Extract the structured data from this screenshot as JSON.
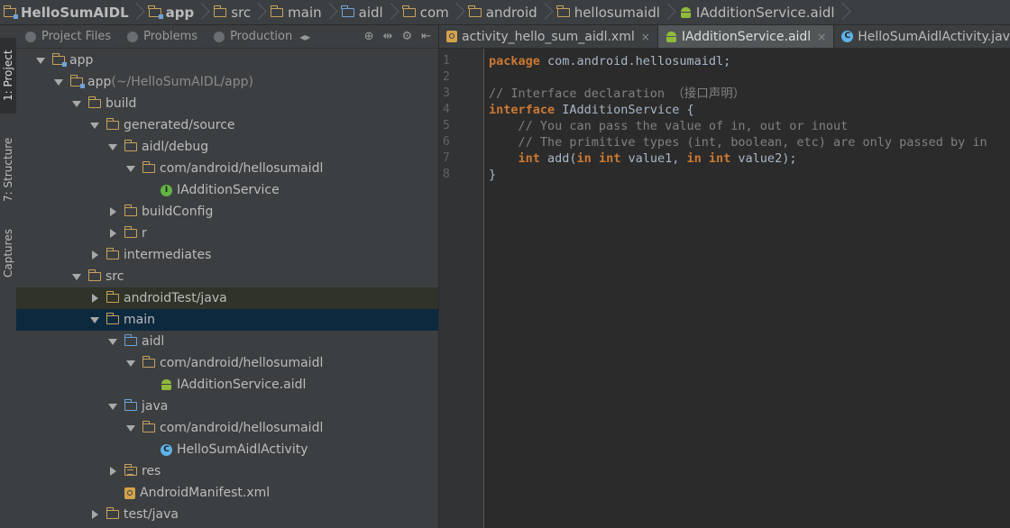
{
  "breadcrumb": [
    {
      "label": "HelloSumAIDL",
      "icon": "module-folder-icon",
      "bold": true
    },
    {
      "label": "app",
      "icon": "module-folder-icon",
      "bold": true
    },
    {
      "label": "src",
      "icon": "folder-icon"
    },
    {
      "label": "main",
      "icon": "folder-icon"
    },
    {
      "label": "aidl",
      "icon": "blue-folder-icon"
    },
    {
      "label": "com",
      "icon": "folder-icon"
    },
    {
      "label": "android",
      "icon": "folder-icon"
    },
    {
      "label": "hellosumaidl",
      "icon": "folder-icon"
    },
    {
      "label": "IAdditionService.aidl",
      "icon": "android-icon"
    }
  ],
  "left_stripe": {
    "project": "1: Project",
    "structure": "7: Structure",
    "captures": "Captures"
  },
  "panel_tabs": [
    "Project Files",
    "Problems",
    "Production"
  ],
  "panel_tools": {
    "arrows": "◂▸",
    "target": "⊕",
    "split": "⇹",
    "gear": "⚙",
    "hide": "⇤"
  },
  "tree": [
    {
      "label": "app",
      "suffix": "",
      "indent": 0,
      "arrow": "down",
      "icon": "module-folder-icon"
    },
    {
      "label": "app",
      "suffix": " (~/HelloSumAIDL/app)",
      "indent": 1,
      "arrow": "down",
      "icon": "module-folder-icon"
    },
    {
      "label": "build",
      "suffix": "",
      "indent": 2,
      "arrow": "down",
      "icon": "folder-icon"
    },
    {
      "label": "generated/source",
      "suffix": "",
      "indent": 3,
      "arrow": "down",
      "icon": "folder-icon"
    },
    {
      "label": "aidl/debug",
      "suffix": "",
      "indent": 4,
      "arrow": "down",
      "icon": "folder-icon"
    },
    {
      "label": "com/android/hellosumaidl",
      "suffix": "",
      "indent": 5,
      "arrow": "down",
      "icon": "folder-icon"
    },
    {
      "label": "IAdditionService",
      "suffix": "",
      "indent": 6,
      "arrow": "none",
      "icon": "interface-icon"
    },
    {
      "label": "buildConfig",
      "suffix": "",
      "indent": 4,
      "arrow": "right",
      "icon": "folder-icon"
    },
    {
      "label": "r",
      "suffix": "",
      "indent": 4,
      "arrow": "right",
      "icon": "folder-icon"
    },
    {
      "label": "intermediates",
      "suffix": "",
      "indent": 3,
      "arrow": "right",
      "icon": "folder-icon"
    },
    {
      "label": "src",
      "suffix": "",
      "indent": 2,
      "arrow": "down",
      "icon": "folder-icon"
    },
    {
      "label": "androidTest/java",
      "suffix": "",
      "indent": 3,
      "arrow": "right",
      "icon": "folder-icon",
      "state": "tested"
    },
    {
      "label": "main",
      "suffix": "",
      "indent": 3,
      "arrow": "down",
      "icon": "folder-icon",
      "state": "selected"
    },
    {
      "label": "aidl",
      "suffix": "",
      "indent": 4,
      "arrow": "down",
      "icon": "blue-folder-icon"
    },
    {
      "label": "com/android/hellosumaidl",
      "suffix": "",
      "indent": 5,
      "arrow": "down",
      "icon": "folder-icon"
    },
    {
      "label": "IAdditionService.aidl",
      "suffix": "",
      "indent": 6,
      "arrow": "none",
      "icon": "android-icon"
    },
    {
      "label": "java",
      "suffix": "",
      "indent": 4,
      "arrow": "down",
      "icon": "blue-folder-icon"
    },
    {
      "label": "com/android/hellosumaidl",
      "suffix": "",
      "indent": 5,
      "arrow": "down",
      "icon": "folder-icon"
    },
    {
      "label": "HelloSumAidlActivity",
      "suffix": "",
      "indent": 6,
      "arrow": "none",
      "icon": "class-icon"
    },
    {
      "label": "res",
      "suffix": "",
      "indent": 4,
      "arrow": "right",
      "icon": "res-folder-icon"
    },
    {
      "label": "AndroidManifest.xml",
      "suffix": "",
      "indent": 4,
      "arrow": "none",
      "icon": "xml-icon"
    },
    {
      "label": "test/java",
      "suffix": "",
      "indent": 3,
      "arrow": "right",
      "icon": "folder-icon"
    }
  ],
  "editor_tabs": [
    {
      "label": "activity_hello_sum_aidl.xml",
      "icon": "xml-icon",
      "active": false
    },
    {
      "label": "IAdditionService.aidl",
      "icon": "android-icon",
      "active": true
    },
    {
      "label": "HelloSumAidlActivity.java",
      "icon": "class-icon",
      "active": false
    }
  ],
  "editor_close_glyph": "×",
  "code_lines": [
    [
      {
        "t": "package",
        "c": "kw"
      },
      {
        "t": " com.android.hellosumaidl;",
        "c": ""
      }
    ],
    [],
    [
      {
        "t": "// Interface declaration （接口声明）",
        "c": "cm"
      }
    ],
    [
      {
        "t": "interface",
        "c": "kw"
      },
      {
        "t": " IAdditionService {",
        "c": ""
      }
    ],
    [
      {
        "t": "    // You can pass the value of in, out or inout",
        "c": "cm"
      }
    ],
    [
      {
        "t": "    // The primitive types (int, boolean, etc) are only passed by in",
        "c": "cm"
      }
    ],
    [
      {
        "t": "    ",
        "c": ""
      },
      {
        "t": "int",
        "c": "kw"
      },
      {
        "t": " add(",
        "c": ""
      },
      {
        "t": "in",
        "c": "kw"
      },
      {
        "t": " ",
        "c": ""
      },
      {
        "t": "int",
        "c": "kw"
      },
      {
        "t": " value1, ",
        "c": ""
      },
      {
        "t": "in",
        "c": "kw"
      },
      {
        "t": " ",
        "c": ""
      },
      {
        "t": "int",
        "c": "kw"
      },
      {
        "t": " value2);",
        "c": ""
      }
    ],
    [
      {
        "t": "}",
        "c": ""
      }
    ]
  ],
  "line_numbers": [
    "1",
    "2",
    "3",
    "4",
    "5",
    "6",
    "7",
    "8"
  ],
  "colors": {
    "background": "#2b2b2b",
    "panel": "#3c3f41",
    "selected_row": "#0d293e",
    "keyword": "#cc7832",
    "comment": "#808080",
    "text": "#a9b7c6"
  }
}
